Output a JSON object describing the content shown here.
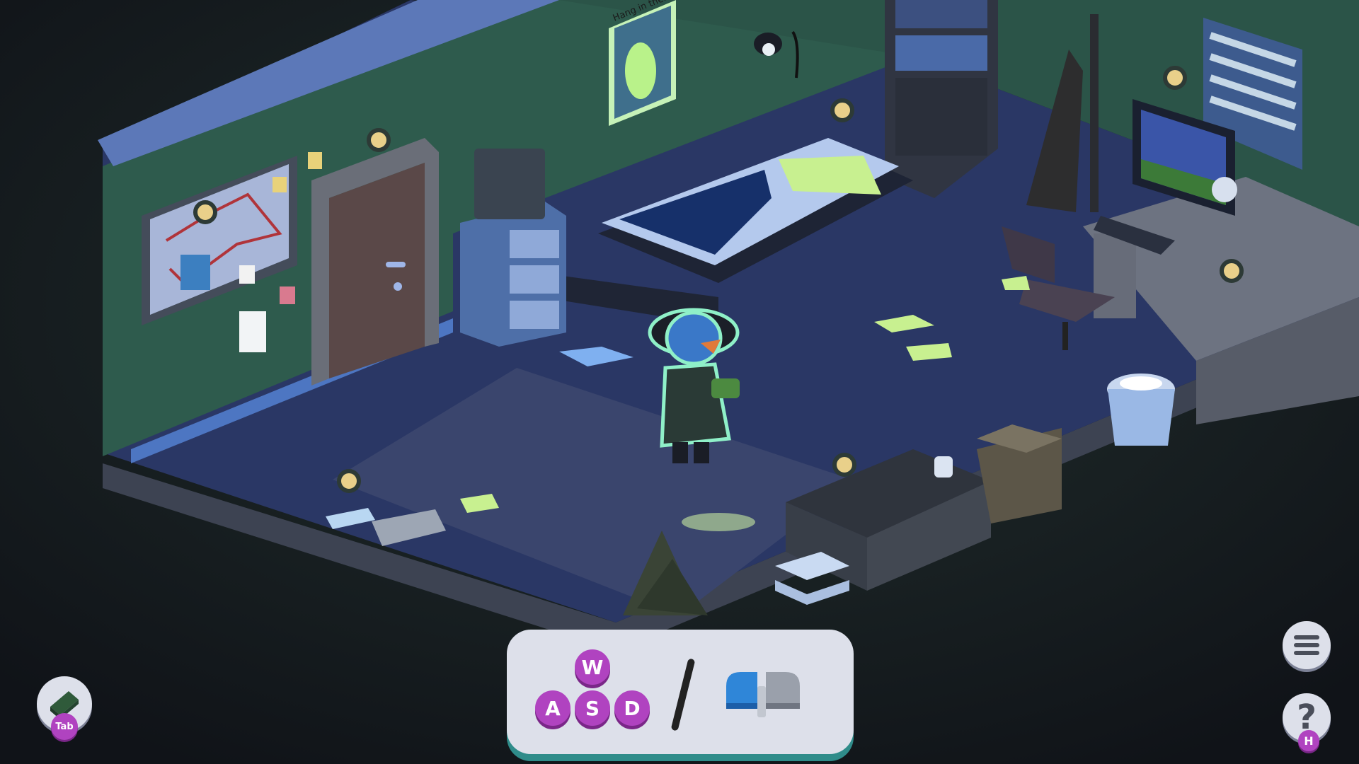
{
  "scene": {
    "poster_text": "Hang in there",
    "colors": {
      "background": "#14171c",
      "wall": "#2f5a4e",
      "floor": "#2b3a6a",
      "floor_side": "#3f4556",
      "highlight": "#b9f28a",
      "accent_purple": "#b043c0"
    }
  },
  "hud": {
    "controls": {
      "keys": [
        "W",
        "A",
        "S",
        "D"
      ],
      "mouse_icon": "mouse-left-click-icon"
    },
    "journal_button": {
      "icon": "notebook-icon",
      "key": "Tab"
    },
    "menu_button": {
      "icon": "hamburger-menu-icon"
    },
    "help_button": {
      "icon": "question-mark-icon",
      "symbol": "?",
      "key": "H"
    }
  }
}
